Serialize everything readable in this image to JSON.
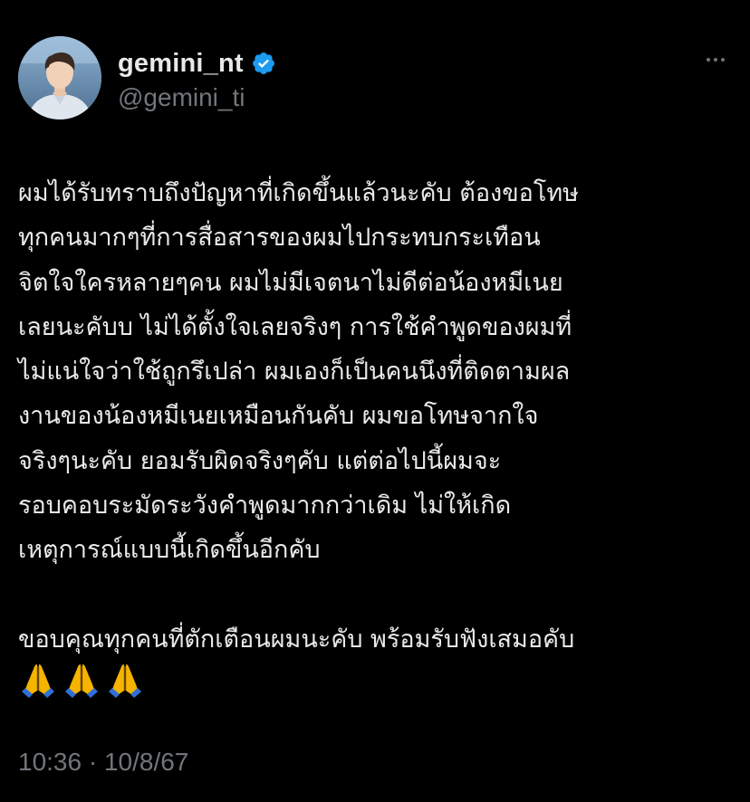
{
  "author": {
    "display_name": "gemini_nt",
    "handle": "@gemini_ti",
    "verified": true,
    "verified_badge_color": "#1d9bf0",
    "avatar_icon": "profile-photo"
  },
  "menu": {
    "icon": "more-horizontal-icon"
  },
  "tweet": {
    "lines": [
      "ผมได้รับทราบถึงปัญหาที่เกิดขึ้นแล้วนะคับ ต้องขอโทษ",
      "ทุกคนมากๆที่การสื่อสารของผมไปกระทบกระเทือน",
      "จิตใจใครหลายๆคน ผมไม่มีเจตนาไม่ดีต่อน้องหมีเนย",
      "เลยนะคับบ ไม่ได้ตั้งใจเลยจริงๆ การใช้คำพูดของผมที่",
      "ไม่แน่ใจว่าใช้ถูกรึเปล่า ผมเองก็เป็นคนนึงที่ติดตามผล",
      "งานของน้องหมีเนยเหมือนกันคับ ผมขอโทษจากใจ",
      "จริงๆนะคับ ยอมรับผิดจริงๆคับ แต่ต่อไปนี้ผมจะ",
      "รอบคอบระมัดระวังคำพูดมากกว่าเดิม ไม่ให้เกิด",
      "เหตุการณ์แบบนี้เกิดขึ้นอีกคับ"
    ],
    "closing_line": "ขอบคุณทุกคนที่ตักเตือนผมนะคับ พร้อมรับฟังเสมอคับ",
    "emojis": [
      "folded-hands-icon",
      "folded-hands-icon",
      "folded-hands-icon"
    ]
  },
  "timestamp": "10:36 · 10/8/67",
  "colors": {
    "background": "#000000",
    "text": "#e7e9ea",
    "secondary": "#71767b"
  }
}
